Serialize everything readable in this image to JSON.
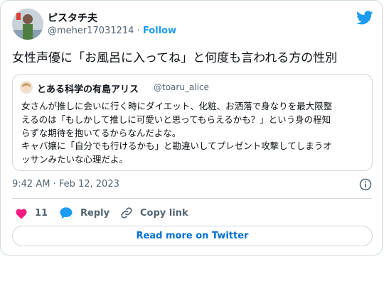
{
  "author": {
    "display_name": "ピスタチ夫",
    "handle": "@meher17031214",
    "separator": "·",
    "follow_label": "Follow"
  },
  "tweet": {
    "text": "女性声優に「お風呂に入ってね」と何度も言われる方の性別"
  },
  "quoted": {
    "display_name": "とある科学の有島アリス",
    "handle": "@toaru_alice",
    "lines": [
      "女さんが推しに会いに行く時にダイエット、化粧、お洒落で身なりを最大限整",
      "えるのは「もしかして推しに可愛いと思ってもらえるかも？」という身の程知",
      "らずな期待を抱いてるからなんだよな。",
      "キャバ嬢に「自分でも行けるかも」と勘違いしてプレゼント攻撃してしまうオ",
      "ッサンみたいな心理だよ。"
    ]
  },
  "meta": {
    "timestamp": "9:42 AM · Feb 12, 2023"
  },
  "actions": {
    "like_count": "11",
    "reply_label": "Reply",
    "copy_link_label": "Copy link"
  },
  "read_more_label": "Read more on Twitter",
  "colors": {
    "accent": "#1d9bf0",
    "heart": "#f91880",
    "link": "#006fd6",
    "muted": "#536471",
    "border": "#cfd9de"
  }
}
